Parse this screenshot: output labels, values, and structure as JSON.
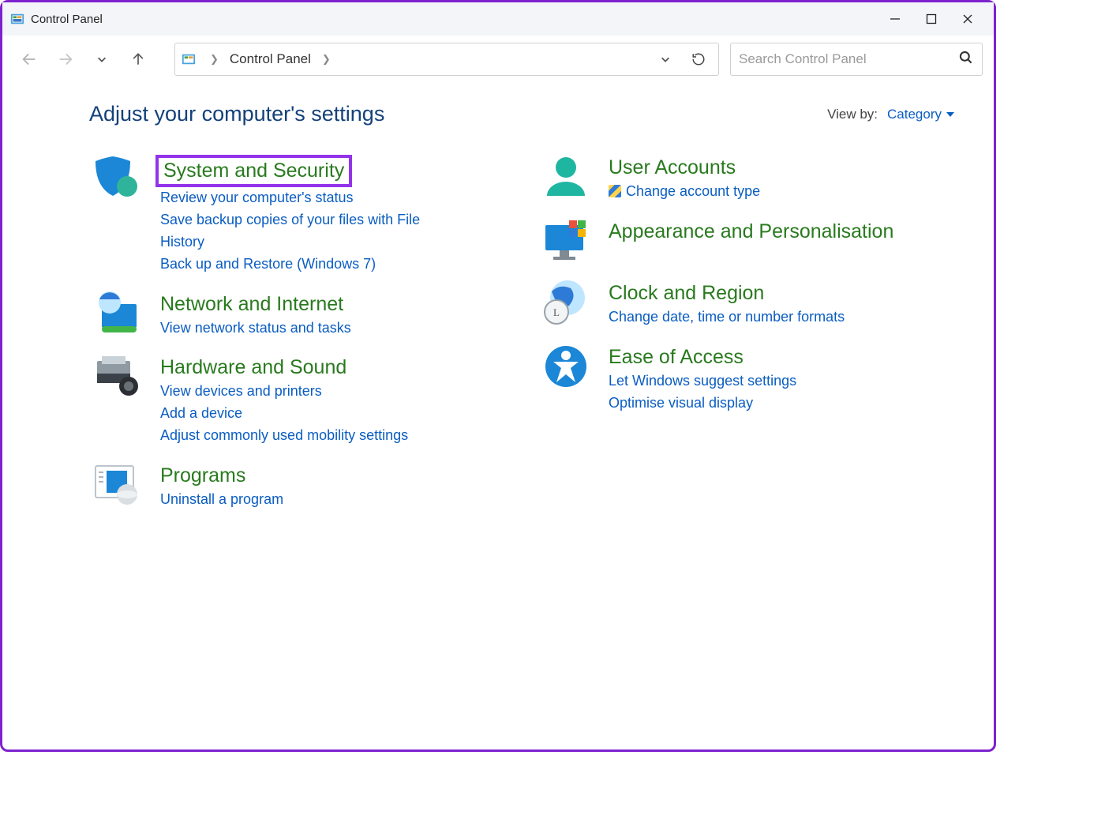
{
  "window": {
    "title": "Control Panel"
  },
  "address": {
    "crumb": "Control Panel"
  },
  "search": {
    "placeholder": "Search Control Panel"
  },
  "header": {
    "title": "Adjust your computer's settings",
    "viewby_label": "View by:",
    "viewby_value": "Category"
  },
  "categories": {
    "left": [
      {
        "title": "System and Security",
        "highlighted": true,
        "subs": [
          "Review your computer's status",
          "Save backup copies of your files with File History",
          "Back up and Restore (Windows 7)"
        ]
      },
      {
        "title": "Network and Internet",
        "subs": [
          "View network status and tasks"
        ]
      },
      {
        "title": "Hardware and Sound",
        "subs": [
          "View devices and printers",
          "Add a device",
          "Adjust commonly used mobility settings"
        ]
      },
      {
        "title": "Programs",
        "subs": [
          "Uninstall a program"
        ]
      }
    ],
    "right": [
      {
        "title": "User Accounts",
        "subs": [
          "Change account type"
        ],
        "shield_on": [
          0
        ]
      },
      {
        "title": "Appearance and Personalisation",
        "subs": []
      },
      {
        "title": "Clock and Region",
        "subs": [
          "Change date, time or number formats"
        ]
      },
      {
        "title": "Ease of Access",
        "subs": [
          "Let Windows suggest settings",
          "Optimise visual display"
        ]
      }
    ]
  }
}
